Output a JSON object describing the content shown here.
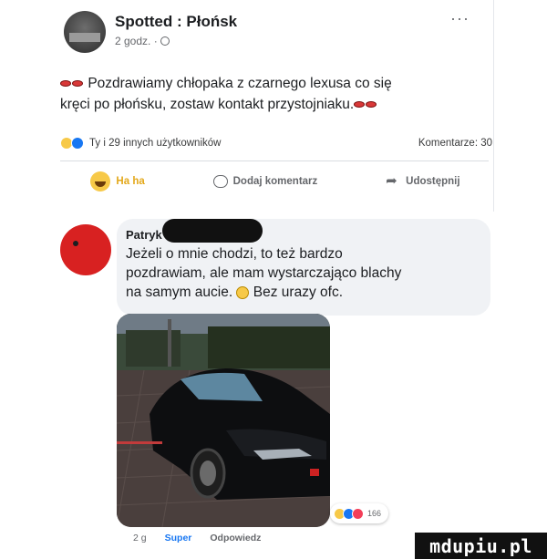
{
  "post": {
    "page_name": "Spotted : Płońsk",
    "time": "2 godz. ·",
    "more_label": "···",
    "text_line1": "Pozdrawiamy chłopaka z czarnego lexusa co się",
    "text_line2": "kręci po płońsku, zostaw kontakt przystojniaku.",
    "reactions_text": "Ty i 29 innych użytkowników",
    "comments_text": "Komentarze: 30",
    "actions": {
      "haha_label": "Ha ha",
      "comment_label": "Dodaj komentarz",
      "share_label": "Udostępnij"
    }
  },
  "comment": {
    "author": "Patryk",
    "text_line1": "Jeżeli o mnie chodzi, to też bardzo",
    "text_line2": "pozdrawiam, ale mam wystarczająco blachy",
    "text_line3": "na samym aucie.",
    "text_line3_after": "Bez urazy ofc.",
    "reaction_count": "166",
    "time": "2 g",
    "like_label": "Super",
    "reply_label": "Odpowiedz"
  },
  "watermark": "mdupiu.pl",
  "icons": {
    "avatar": "page-avatar",
    "globe": "globe-icon",
    "eyes": "eyes-emoji-icon",
    "haha": "haha-reaction-icon",
    "like": "like-reaction-icon",
    "comment": "comment-icon",
    "share": "share-icon",
    "nerd": "nerd-emoji-icon"
  },
  "colors": {
    "accent": "#1877f2",
    "haha": "#f7c948",
    "avatar_red": "#d82121"
  }
}
